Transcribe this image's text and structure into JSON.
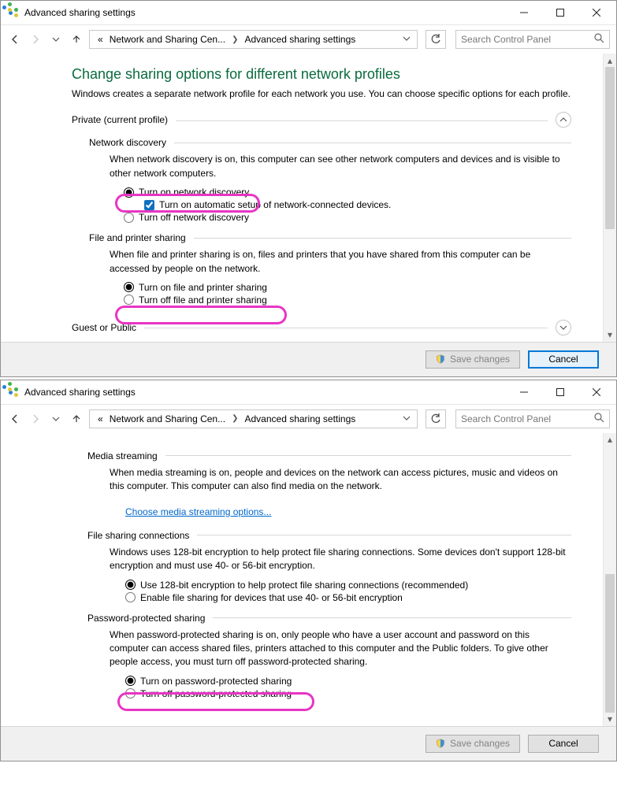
{
  "win1": {
    "title": "Advanced sharing settings",
    "breadcrumb": {
      "a": "«",
      "b": "Network and Sharing Cen...",
      "c": "Advanced sharing settings"
    },
    "search_placeholder": "Search Control Panel",
    "page_title": "Change sharing options for different network profiles",
    "page_sub": "Windows creates a separate network profile for each network you use. You can choose specific options for each profile.",
    "profile_private": "Private (current profile)",
    "sec_netdisc": {
      "head": "Network discovery",
      "desc": "When network discovery is on, this computer can see other network computers and devices and is visible to other network computers.",
      "opt_on": "Turn on network discovery",
      "chk_auto": "Turn on automatic setup of network-connected devices.",
      "opt_off": "Turn off network discovery"
    },
    "sec_fps": {
      "head": "File and printer sharing",
      "desc": "When file and printer sharing is on, files and printers that you have shared from this computer can be accessed by people on the network.",
      "opt_on": "Turn on file and printer sharing",
      "opt_off": "Turn off file and printer sharing"
    },
    "profile_guest": "Guest or Public",
    "save": "Save changes",
    "cancel": "Cancel"
  },
  "win2": {
    "title": "Advanced sharing settings",
    "breadcrumb": {
      "a": "«",
      "b": "Network and Sharing Cen...",
      "c": "Advanced sharing settings"
    },
    "search_placeholder": "Search Control Panel",
    "sec_media": {
      "head": "Media streaming",
      "desc": "When media streaming is on, people and devices on the network can access pictures, music and videos on this computer. This computer can also find media on the network.",
      "link": "Choose media streaming options..."
    },
    "sec_enc": {
      "head": "File sharing connections",
      "desc": "Windows uses 128-bit encryption to help protect file sharing connections. Some devices don't support 128-bit encryption and must use 40- or 56-bit encryption.",
      "opt_a": "Use 128-bit encryption to help protect file sharing connections (recommended)",
      "opt_b": "Enable file sharing for devices that use 40- or 56-bit encryption"
    },
    "sec_pps": {
      "head": "Password-protected sharing",
      "desc": "When password-protected sharing is on, only people who have a user account and password on this computer can access shared files, printers attached to this computer and the Public folders. To give other people access, you must turn off password-protected sharing.",
      "opt_on": "Turn on password-protected sharing",
      "opt_off": "Turn off password-protected sharing"
    },
    "save": "Save changes",
    "cancel": "Cancel"
  }
}
